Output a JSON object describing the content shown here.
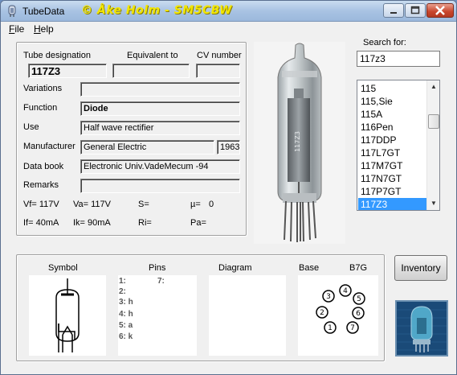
{
  "window": {
    "title": "TubeData",
    "watermark": "© Åke Holm - SM5CBW"
  },
  "menu": [
    {
      "accel": "F",
      "rest": "ile"
    },
    {
      "accel": "H",
      "rest": "elp"
    }
  ],
  "form": {
    "tube_designation_label": "Tube designation",
    "equivalent_label": "Equivalent to",
    "cv_label": "CV number",
    "tube_designation": "117Z3",
    "equivalent": "",
    "cv_number": "",
    "variations_label": "Variations",
    "variations": "",
    "function_label": "Function",
    "function": "Diode",
    "use_label": "Use",
    "use": "Half wave rectifier",
    "manufacturer_label": "Manufacturer",
    "manufacturer": "General Electric",
    "year": "1963",
    "databook_label": "Data book",
    "databook": "Electronic Univ.VadeMecum -94",
    "remarks_label": "Remarks",
    "remarks": ""
  },
  "params": {
    "vf": "Vf= 117V",
    "va": "Va= 117V",
    "s": "S=",
    "mu": "µ=",
    "mu_val": "0",
    "if": "If= 40mA",
    "ik": "Ik= 90mA",
    "ri": "Ri=",
    "pa": "Pa="
  },
  "search": {
    "label": "Search for:",
    "value": "117z3",
    "items": [
      "115",
      "115,Sie",
      "115A",
      "116Pen",
      "117DDP",
      "117L7GT",
      "117M7GT",
      "117N7GT",
      "117P7GT",
      "117Z3"
    ],
    "selected_index": 9
  },
  "bottom": {
    "symbol_label": "Symbol",
    "pins_label": "Pins",
    "diagram_label": "Diagram",
    "base_label": "Base",
    "base_type": "B7G",
    "pins_col1": [
      "1:",
      "2:",
      "3: h",
      "4: h",
      "5: a",
      "6: k"
    ],
    "pins_col2": [
      "7:"
    ],
    "base_pins": [
      "1",
      "2",
      "3",
      "4",
      "5",
      "6",
      "7"
    ]
  },
  "buttons": {
    "inventory": "Inventory"
  },
  "photo": {
    "tube_marking": "117Z3"
  },
  "icons": {
    "app": "tube-app-icon",
    "minimize": "minimize-icon",
    "maximize": "maximize-icon",
    "close": "close-icon",
    "scroll_up": "scroll-up-arrow-icon",
    "scroll_down": "scroll-down-arrow-icon"
  },
  "colors": {
    "watermark": "#f2e600",
    "selection": "#3399ff",
    "close_button": "#c8452b",
    "logo_bg": "#1a4a78"
  }
}
